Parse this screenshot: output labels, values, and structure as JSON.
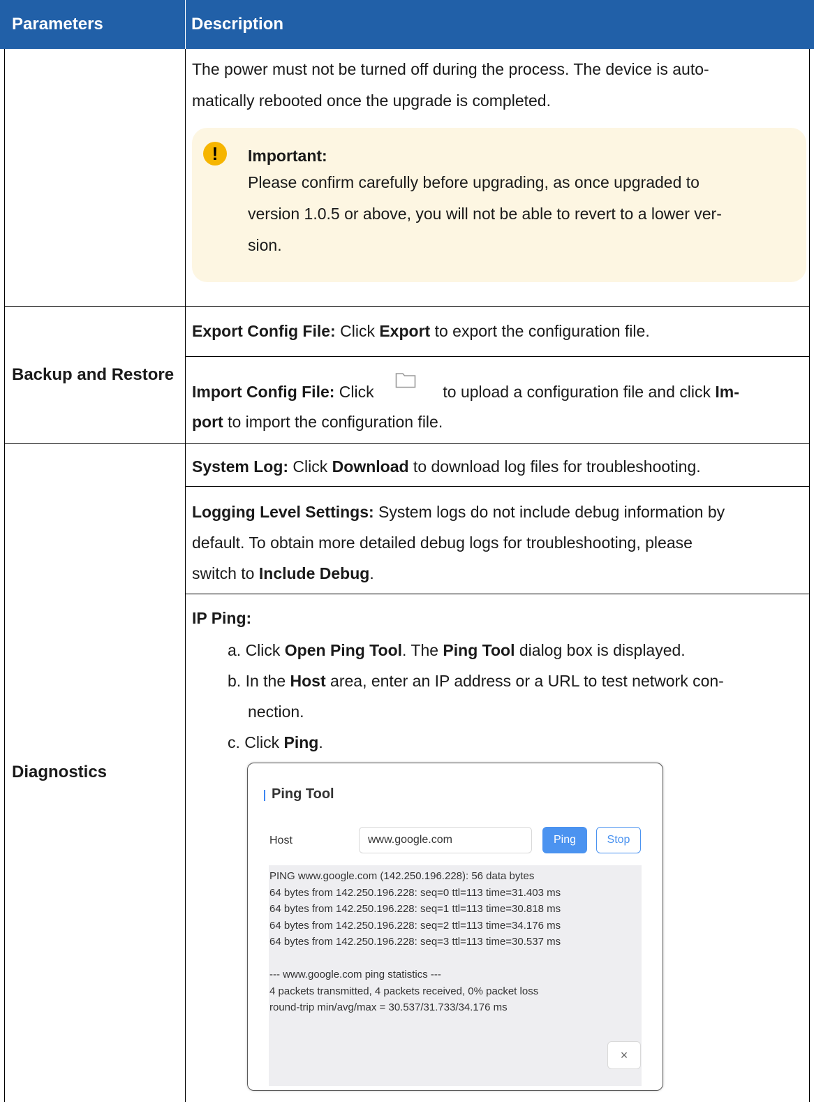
{
  "header": {
    "col1": "Parameters",
    "col2": "Description"
  },
  "upgrade": {
    "line1": "The power must not be turned off during the process. The device is auto-",
    "line2": "matically rebooted once the upgrade is completed.",
    "note_title": "Important:",
    "note_icon": "exclamation-icon",
    "note_lines": [
      "Please confirm carefully before upgrading, as once upgraded to",
      "version 1.0.5 or above, you will not be able to revert to a lower ver-",
      "sion."
    ]
  },
  "backup": {
    "param": "Backup and Restore",
    "export_label": "Export Config File:",
    "export_pre": " Click ",
    "export_bold": "Export",
    "export_post": " to export the configuration file.",
    "import_label": "Import Config File:",
    "import_pre": " Click ",
    "import_icon": "folder-icon",
    "import_post": " to upload a configuration file and click ",
    "import_bold1": "Im-",
    "import_bold2": "port",
    "import_post2": " to import the configuration file."
  },
  "diagnostics": {
    "param": "Diagnostics",
    "syslog_label": "System Log:",
    "syslog_pre": " Click ",
    "syslog_bold": "Download",
    "syslog_post": " to download log files for troubleshooting.",
    "logging_label": "Logging Level Settings:",
    "logging_l1": " System logs do not include debug information by",
    "logging_l2": "default. To obtain more detailed debug logs for troubleshooting, please",
    "logging_l3_pre": "switch to ",
    "logging_l3_bold": "Include Debug",
    "logging_l3_post": ".",
    "ping_label": "IP Ping:",
    "step_a_prefix": "a. Click ",
    "step_a_bold1": "Open Ping Tool",
    "step_a_mid": ". The ",
    "step_a_bold2": "Ping Tool",
    "step_a_post": " dialog box is displayed.",
    "step_b_prefix": "b. In the ",
    "step_b_bold": "Host",
    "step_b_post": " area, enter an IP address or a URL to test network con-",
    "step_b_line2": "nection.",
    "step_c_prefix": "c. Click ",
    "step_c_bold": "Ping",
    "step_c_post": "."
  },
  "ping_dialog": {
    "title": "Ping Tool",
    "host_label": "Host",
    "host_value": "www.google.com",
    "ping_button": "Ping",
    "stop_button": "Stop",
    "close_button": "×",
    "output": [
      "PING www.google.com (142.250.196.228): 56 data bytes",
      "64 bytes from 142.250.196.228: seq=0 ttl=113 time=31.403 ms",
      "64 bytes from 142.250.196.228: seq=1 ttl=113 time=30.818 ms",
      "64 bytes from 142.250.196.228: seq=2 ttl=113 time=34.176 ms",
      "64 bytes from 142.250.196.228: seq=3 ttl=113 time=30.537 ms",
      "",
      "--- www.google.com ping statistics ---",
      "4 packets transmitted, 4 packets received, 0% packet loss",
      "round-trip min/avg/max = 30.537/31.733/34.176 ms"
    ],
    "accent_color": "#4b93f0"
  }
}
